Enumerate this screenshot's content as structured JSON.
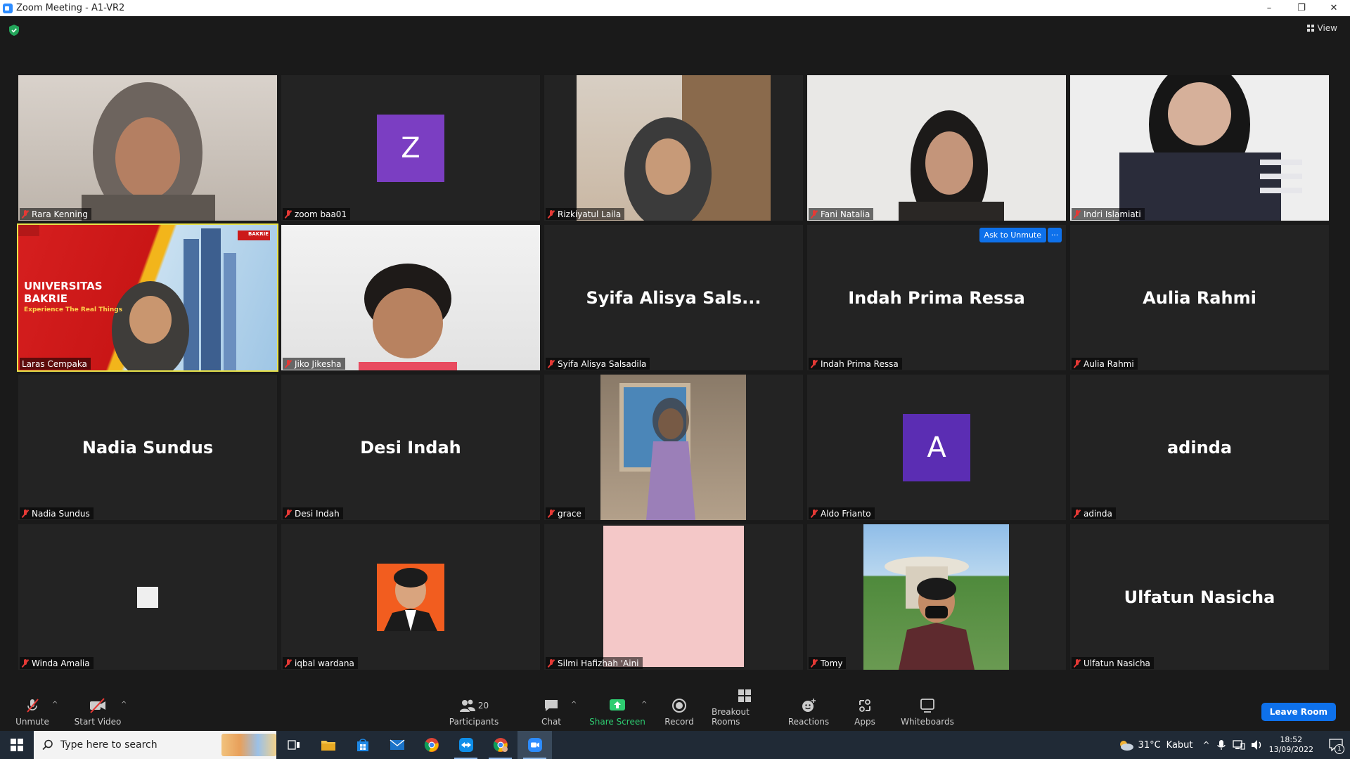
{
  "window": {
    "title": "Zoom Meeting - A1-VR2",
    "minimize": "–",
    "restore": "❐",
    "close": "✕"
  },
  "topbar": {
    "view_label": "View"
  },
  "tiles": [
    {
      "name": "Rara Kenning",
      "kind": "video",
      "muted": true
    },
    {
      "name": "zoom baa01",
      "kind": "avatar",
      "avatar_letter": "Z",
      "muted": true
    },
    {
      "name": "Rizkiyatul Laila",
      "kind": "video",
      "muted": true
    },
    {
      "name": "Fani Natalia",
      "kind": "video",
      "muted": true
    },
    {
      "name": "Indri Islamiati",
      "kind": "video",
      "muted": true
    },
    {
      "name": "Laras Cempaka",
      "kind": "video",
      "muted": false,
      "active_speaker": true,
      "background_text": [
        "UNIVERSITAS",
        "BAKRIE",
        "Experience The Real Things"
      ],
      "logo_text": "BAKRIE"
    },
    {
      "name": "Jiko Jikesha",
      "kind": "video",
      "muted": true
    },
    {
      "name": "Syifa Alisya Salsadila",
      "big_name": "Syifa Alisya Sals...",
      "kind": "name",
      "muted": true
    },
    {
      "name": "Indah Prima Ressa",
      "big_name": "Indah Prima Ressa",
      "kind": "name",
      "muted": true,
      "ask_unmute": "Ask to Unmute",
      "more": "···"
    },
    {
      "name": "Aulia Rahmi",
      "big_name": "Aulia Rahmi",
      "kind": "name",
      "muted": true
    },
    {
      "name": "Nadia Sundus",
      "big_name": "Nadia Sundus",
      "kind": "name",
      "muted": true
    },
    {
      "name": "Desi Indah",
      "big_name": "Desi Indah",
      "kind": "name",
      "muted": true
    },
    {
      "name": "grace",
      "kind": "video",
      "muted": true
    },
    {
      "name": "Aldo Frianto",
      "kind": "avatar",
      "avatar_letter": "A",
      "muted": true
    },
    {
      "name": "adinda",
      "big_name": "adinda",
      "kind": "name",
      "muted": true
    },
    {
      "name": "Winda Amalia",
      "kind": "square",
      "muted": true
    },
    {
      "name": "iqbal wardana",
      "kind": "photo",
      "muted": true
    },
    {
      "name": "Silmi Hafizhah 'Aini",
      "kind": "pink",
      "muted": true
    },
    {
      "name": "Tomy",
      "kind": "photo",
      "muted": true
    },
    {
      "name": "Ulfatun Nasicha",
      "big_name": "Ulfatun Nasicha",
      "kind": "name",
      "muted": true
    }
  ],
  "toolbar": {
    "unmute": "Unmute",
    "start_video": "Start Video",
    "participants": "Participants",
    "participants_count": "20",
    "chat": "Chat",
    "share_screen": "Share Screen",
    "record": "Record",
    "breakout_rooms": "Breakout Rooms",
    "reactions": "Reactions",
    "apps": "Apps",
    "whiteboards": "Whiteboards",
    "leave_room": "Leave Room"
  },
  "taskbar": {
    "search_placeholder": "Type here to search",
    "weather_temp": "31°C",
    "weather_desc": "Kabut",
    "time": "18:52",
    "date": "13/09/2022",
    "notification_count": "1"
  },
  "colors": {
    "active_speaker_border": "#e9e34a",
    "accent_blue": "#0e71eb",
    "share_green": "#2ecc71",
    "muted_red": "#e53935"
  }
}
